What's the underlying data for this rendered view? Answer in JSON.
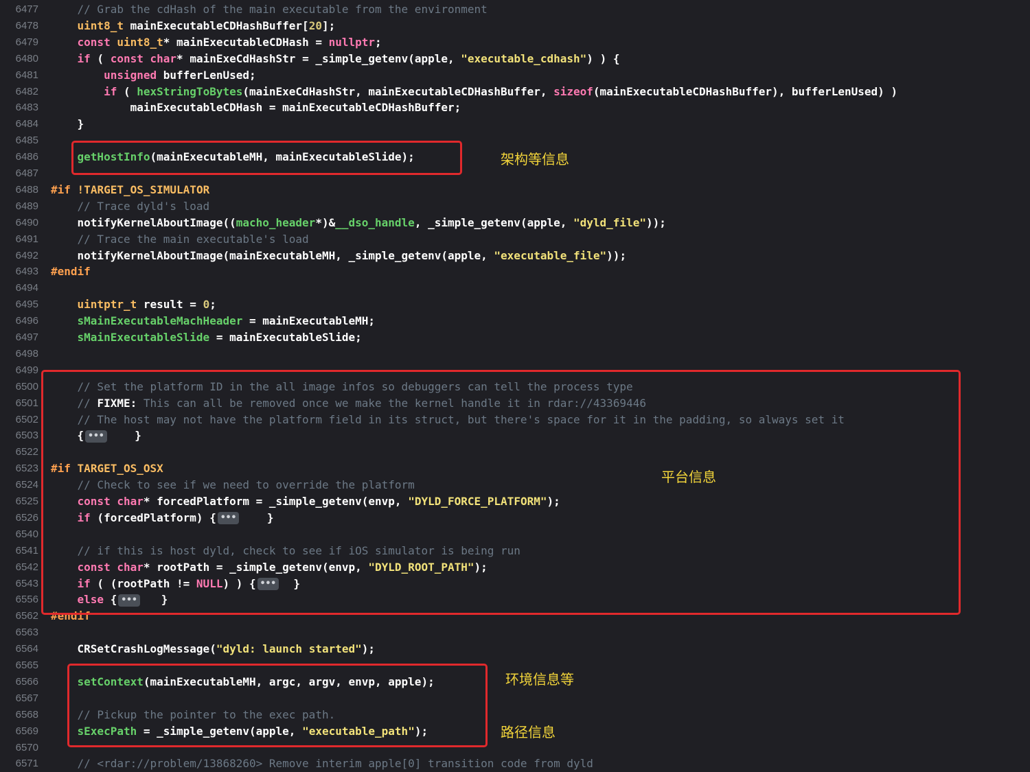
{
  "colors": {
    "background": "#1f1f24",
    "keyword": "#ff7ab2",
    "type": "#fabd63",
    "function": "#67d16a",
    "string": "#f2e27a",
    "comment": "#6c7986",
    "preprocessor": "#ffa14f",
    "plain": "#ffffff",
    "annotation_box": "#e0292c",
    "annotation_text": "#f2d43a"
  },
  "lines": [
    {
      "n": "6477",
      "tokens": [
        [
          "cm",
          "    // Grab the cdHash of the main executable from the environment"
        ]
      ]
    },
    {
      "n": "6478",
      "tokens": [
        [
          "pl",
          "    "
        ],
        [
          "ty",
          "uint8_t"
        ],
        [
          "pl",
          " mainExecutableCDHashBuffer["
        ],
        [
          "num",
          "20"
        ],
        [
          "pl",
          "];"
        ]
      ]
    },
    {
      "n": "6479",
      "tokens": [
        [
          "pl",
          "    "
        ],
        [
          "kw",
          "const"
        ],
        [
          "pl",
          " "
        ],
        [
          "ty",
          "uint8_t"
        ],
        [
          "pl",
          "* mainExecutableCDHash = "
        ],
        [
          "kw",
          "nullptr"
        ],
        [
          "pl",
          ";"
        ]
      ]
    },
    {
      "n": "6480",
      "tokens": [
        [
          "pl",
          "    "
        ],
        [
          "kw",
          "if"
        ],
        [
          "pl",
          " ( "
        ],
        [
          "kw",
          "const"
        ],
        [
          "pl",
          " "
        ],
        [
          "kw",
          "char"
        ],
        [
          "pl",
          "* mainExeCdHashStr = _simple_getenv(apple, "
        ],
        [
          "str",
          "\"executable_cdhash\""
        ],
        [
          "pl",
          ") ) {"
        ]
      ]
    },
    {
      "n": "6481",
      "tokens": [
        [
          "pl",
          "        "
        ],
        [
          "kw",
          "unsigned"
        ],
        [
          "pl",
          " bufferLenUsed;"
        ]
      ]
    },
    {
      "n": "6482",
      "tokens": [
        [
          "pl",
          "        "
        ],
        [
          "kw",
          "if"
        ],
        [
          "pl",
          " ( "
        ],
        [
          "fn",
          "hexStringToBytes"
        ],
        [
          "pl",
          "(mainExeCdHashStr, mainExecutableCDHashBuffer, "
        ],
        [
          "kw",
          "sizeof"
        ],
        [
          "pl",
          "(mainExecutableCDHashBuffer), bufferLenUsed) )"
        ]
      ]
    },
    {
      "n": "6483",
      "tokens": [
        [
          "pl",
          "            mainExecutableCDHash = mainExecutableCDHashBuffer;"
        ]
      ]
    },
    {
      "n": "6484",
      "tokens": [
        [
          "pl",
          "    }"
        ]
      ]
    },
    {
      "n": "6485",
      "tokens": []
    },
    {
      "n": "6486",
      "tokens": [
        [
          "pl",
          "    "
        ],
        [
          "fn",
          "getHostInfo"
        ],
        [
          "pl",
          "(mainExecutableMH, mainExecutableSlide);"
        ]
      ]
    },
    {
      "n": "6487",
      "tokens": []
    },
    {
      "n": "6488",
      "tokens": [
        [
          "pp",
          "#if"
        ],
        [
          "pl",
          " "
        ],
        [
          "ty",
          "!TARGET_OS_SIMULATOR"
        ]
      ]
    },
    {
      "n": "6489",
      "tokens": [
        [
          "cm",
          "    // Trace dyld's load"
        ]
      ]
    },
    {
      "n": "6490",
      "tokens": [
        [
          "pl",
          "    notifyKernelAboutImage(("
        ],
        [
          "fn",
          "macho_header"
        ],
        [
          "pl",
          "*)&"
        ],
        [
          "fn",
          "__dso_handle"
        ],
        [
          "pl",
          ", _simple_getenv(apple, "
        ],
        [
          "str",
          "\"dyld_file\""
        ],
        [
          "pl",
          "));"
        ]
      ]
    },
    {
      "n": "6491",
      "tokens": [
        [
          "cm",
          "    // Trace the main executable's load"
        ]
      ]
    },
    {
      "n": "6492",
      "tokens": [
        [
          "pl",
          "    notifyKernelAboutImage(mainExecutableMH, _simple_getenv(apple, "
        ],
        [
          "str",
          "\"executable_file\""
        ],
        [
          "pl",
          "));"
        ]
      ]
    },
    {
      "n": "6493",
      "tokens": [
        [
          "pp",
          "#endif"
        ]
      ]
    },
    {
      "n": "6494",
      "tokens": []
    },
    {
      "n": "6495",
      "tokens": [
        [
          "pl",
          "    "
        ],
        [
          "ty",
          "uintptr_t"
        ],
        [
          "pl",
          " result = "
        ],
        [
          "num",
          "0"
        ],
        [
          "pl",
          ";"
        ]
      ]
    },
    {
      "n": "6496",
      "tokens": [
        [
          "pl",
          "    "
        ],
        [
          "fn",
          "sMainExecutableMachHeader"
        ],
        [
          "pl",
          " = mainExecutableMH;"
        ]
      ]
    },
    {
      "n": "6497",
      "tokens": [
        [
          "pl",
          "    "
        ],
        [
          "fn",
          "sMainExecutableSlide"
        ],
        [
          "pl",
          " = mainExecutableSlide;"
        ]
      ]
    },
    {
      "n": "6498",
      "tokens": []
    },
    {
      "n": "6499",
      "tokens": []
    },
    {
      "n": "6500",
      "tokens": [
        [
          "cm",
          "    // Set the platform ID in the all image infos so debuggers can tell the process type"
        ]
      ]
    },
    {
      "n": "6501",
      "tokens": [
        [
          "cm",
          "    // "
        ],
        [
          "pl",
          "FIXME:"
        ],
        [
          "cm",
          " This can all be removed once we make the kernel handle it in rdar://43369446"
        ]
      ]
    },
    {
      "n": "6502",
      "tokens": [
        [
          "cm",
          "    // The host may not have the platform field in its struct, but there's space for it in the padding, so always set it"
        ]
      ]
    },
    {
      "n": "6503",
      "tokens": [
        [
          "pl",
          "    {"
        ],
        [
          "fold",
          "•••"
        ],
        [
          "pl",
          "    }"
        ]
      ]
    },
    {
      "n": "6522",
      "tokens": []
    },
    {
      "n": "6523",
      "tokens": [
        [
          "pp",
          "#if"
        ],
        [
          "pl",
          " "
        ],
        [
          "ty",
          "TARGET_OS_OSX"
        ]
      ]
    },
    {
      "n": "6524",
      "tokens": [
        [
          "cm",
          "    // Check to see if we need to override the platform"
        ]
      ]
    },
    {
      "n": "6525",
      "tokens": [
        [
          "pl",
          "    "
        ],
        [
          "kw",
          "const"
        ],
        [
          "pl",
          " "
        ],
        [
          "kw",
          "char"
        ],
        [
          "pl",
          "* forcedPlatform = _simple_getenv(envp, "
        ],
        [
          "str",
          "\"DYLD_FORCE_PLATFORM\""
        ],
        [
          "pl",
          ");"
        ]
      ]
    },
    {
      "n": "6526",
      "tokens": [
        [
          "pl",
          "    "
        ],
        [
          "kw",
          "if"
        ],
        [
          "pl",
          " (forcedPlatform) {"
        ],
        [
          "fold",
          "•••"
        ],
        [
          "pl",
          "    }"
        ]
      ]
    },
    {
      "n": "6540",
      "tokens": []
    },
    {
      "n": "6541",
      "tokens": [
        [
          "cm",
          "    // if this is host dyld, check to see if iOS simulator is being run"
        ]
      ]
    },
    {
      "n": "6542",
      "tokens": [
        [
          "pl",
          "    "
        ],
        [
          "kw",
          "const"
        ],
        [
          "pl",
          " "
        ],
        [
          "kw",
          "char"
        ],
        [
          "pl",
          "* rootPath = _simple_getenv(envp, "
        ],
        [
          "str",
          "\"DYLD_ROOT_PATH\""
        ],
        [
          "pl",
          ");"
        ]
      ]
    },
    {
      "n": "6543",
      "tokens": [
        [
          "pl",
          "    "
        ],
        [
          "kw",
          "if"
        ],
        [
          "pl",
          " ( (rootPath != "
        ],
        [
          "kw",
          "NULL"
        ],
        [
          "pl",
          ") ) {"
        ],
        [
          "fold",
          "•••"
        ],
        [
          "pl",
          "  }"
        ]
      ]
    },
    {
      "n": "6556",
      "tokens": [
        [
          "pl",
          "    "
        ],
        [
          "kw",
          "else"
        ],
        [
          "pl",
          " {"
        ],
        [
          "fold",
          "•••"
        ],
        [
          "pl",
          "   }"
        ]
      ]
    },
    {
      "n": "6562",
      "tokens": [
        [
          "pp",
          "#endif"
        ]
      ]
    },
    {
      "n": "6563",
      "tokens": []
    },
    {
      "n": "6564",
      "tokens": [
        [
          "pl",
          "    CRSetCrashLogMessage("
        ],
        [
          "str",
          "\"dyld: launch started\""
        ],
        [
          "pl",
          ");"
        ]
      ]
    },
    {
      "n": "6565",
      "tokens": []
    },
    {
      "n": "6566",
      "tokens": [
        [
          "pl",
          "    "
        ],
        [
          "fn",
          "setContext"
        ],
        [
          "pl",
          "(mainExecutableMH, argc, argv, envp, apple);"
        ]
      ]
    },
    {
      "n": "6567",
      "tokens": []
    },
    {
      "n": "6568",
      "tokens": [
        [
          "cm",
          "    // Pickup the pointer to the exec path."
        ]
      ]
    },
    {
      "n": "6569",
      "tokens": [
        [
          "pl",
          "    "
        ],
        [
          "fn",
          "sExecPath"
        ],
        [
          "pl",
          " = _simple_getenv(apple, "
        ],
        [
          "str",
          "\"executable_path\""
        ],
        [
          "pl",
          ");"
        ]
      ]
    },
    {
      "n": "6570",
      "tokens": []
    },
    {
      "n": "6571",
      "tokens": [
        [
          "cm",
          "    // <rdar://problem/13868260> Remove interim apple[0] transition code from dyld"
        ]
      ]
    }
  ],
  "annotations": {
    "host_info": "架构等信息",
    "platform_info": "平台信息",
    "env_info": "环境信息等",
    "path_info": "路径信息"
  }
}
